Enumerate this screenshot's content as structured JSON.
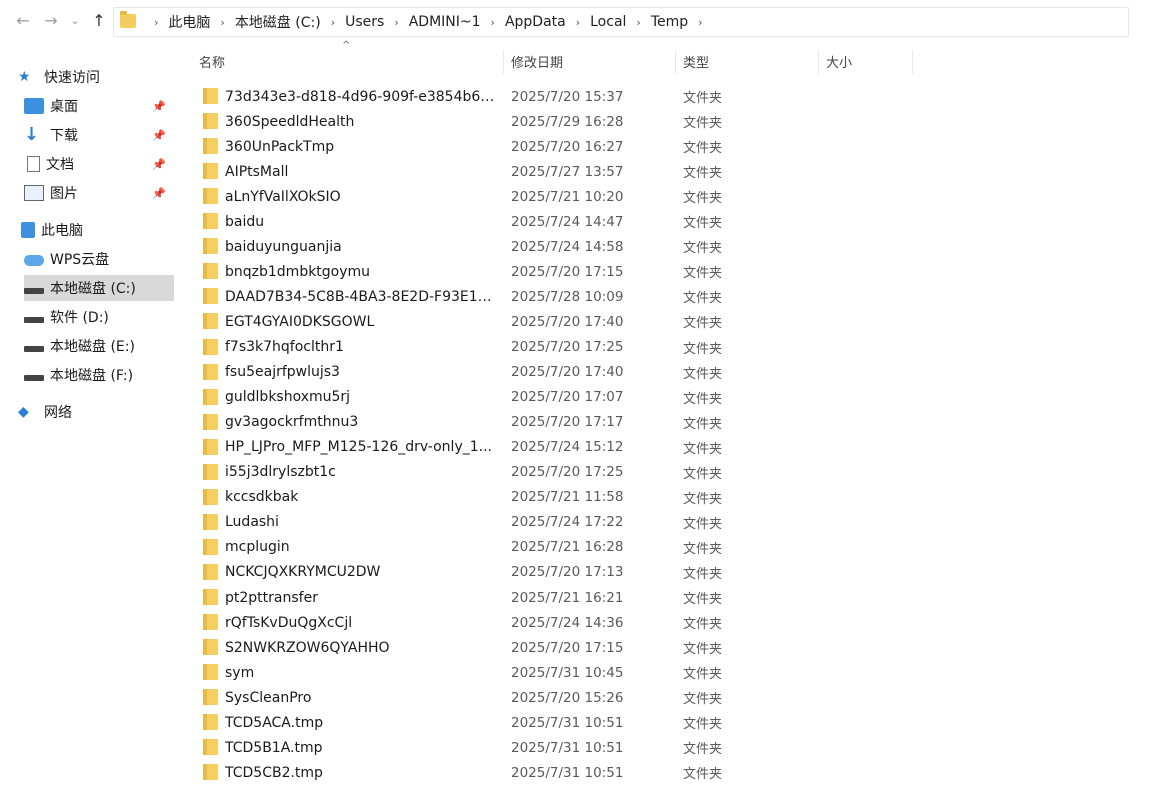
{
  "address_bar": {
    "crumbs": [
      "此电脑",
      "本地磁盘 (C:)",
      "Users",
      "ADMINI~1",
      "AppData",
      "Local",
      "Temp"
    ]
  },
  "nav_icons": {
    "back": "←",
    "forward": "→",
    "recent": "⌄",
    "up": "↑"
  },
  "sidebar": {
    "quick_access": {
      "label": "快速访问",
      "items": [
        {
          "label": "桌面",
          "icon": "desktop-icon",
          "pinned": true
        },
        {
          "label": "下载",
          "icon": "download-icon",
          "pinned": true
        },
        {
          "label": "文档",
          "icon": "document-icon",
          "pinned": true
        },
        {
          "label": "图片",
          "icon": "picture-icon",
          "pinned": true
        }
      ]
    },
    "this_pc": {
      "label": "此电脑"
    },
    "drives": [
      {
        "label": "WPS云盘",
        "icon": "cloud-icon",
        "selected": false
      },
      {
        "label": "本地磁盘 (C:)",
        "icon": "drive-icon",
        "selected": true
      },
      {
        "label": "软件 (D:)",
        "icon": "drive-icon",
        "selected": false
      },
      {
        "label": "本地磁盘 (E:)",
        "icon": "drive-icon",
        "selected": false
      },
      {
        "label": "本地磁盘 (F:)",
        "icon": "drive-icon",
        "selected": false
      }
    ],
    "network": {
      "label": "网络"
    }
  },
  "columns": {
    "name": "名称",
    "date": "修改日期",
    "type": "类型",
    "size": "大小",
    "sort_caret": "^"
  },
  "files": [
    {
      "name": "73d343e3-d818-4d96-909f-e3854b68...",
      "date": "2025/7/20 15:37",
      "type": "文件夹"
    },
    {
      "name": "360SpeedldHealth",
      "date": "2025/7/29 16:28",
      "type": "文件夹"
    },
    {
      "name": "360UnPackTmp",
      "date": "2025/7/20 16:27",
      "type": "文件夹"
    },
    {
      "name": "AIPtsMall",
      "date": "2025/7/27 13:57",
      "type": "文件夹"
    },
    {
      "name": "aLnYfVaIlXOkSIO",
      "date": "2025/7/21 10:20",
      "type": "文件夹"
    },
    {
      "name": "baidu",
      "date": "2025/7/24 14:47",
      "type": "文件夹"
    },
    {
      "name": "baiduyunguanjia",
      "date": "2025/7/24 14:58",
      "type": "文件夹"
    },
    {
      "name": "bnqzb1dmbktgoymu",
      "date": "2025/7/20 17:15",
      "type": "文件夹"
    },
    {
      "name": "DAAD7B34-5C8B-4BA3-8E2D-F93E12...",
      "date": "2025/7/28 10:09",
      "type": "文件夹"
    },
    {
      "name": "EGT4GYAI0DKSGOWL",
      "date": "2025/7/20 17:40",
      "type": "文件夹"
    },
    {
      "name": "f7s3k7hqfoclthr1",
      "date": "2025/7/20 17:25",
      "type": "文件夹"
    },
    {
      "name": "fsu5eajrfpwlujs3",
      "date": "2025/7/20 17:40",
      "type": "文件夹"
    },
    {
      "name": "guldlbkshoxmu5rj",
      "date": "2025/7/20 17:07",
      "type": "文件夹"
    },
    {
      "name": "gv3agockrfmthnu3",
      "date": "2025/7/20 17:17",
      "type": "文件夹"
    },
    {
      "name": "HP_LJPro_MFP_M125-126_drv-only_1...",
      "date": "2025/7/24 15:12",
      "type": "文件夹"
    },
    {
      "name": "i55j3dlrylszbt1c",
      "date": "2025/7/20 17:25",
      "type": "文件夹"
    },
    {
      "name": "kccsdkbak",
      "date": "2025/7/21 11:58",
      "type": "文件夹"
    },
    {
      "name": "Ludashi",
      "date": "2025/7/24 17:22",
      "type": "文件夹"
    },
    {
      "name": "mcplugin",
      "date": "2025/7/21 16:28",
      "type": "文件夹"
    },
    {
      "name": "NCKCJQXKRYMCU2DW",
      "date": "2025/7/20 17:13",
      "type": "文件夹"
    },
    {
      "name": "pt2pttransfer",
      "date": "2025/7/21 16:21",
      "type": "文件夹"
    },
    {
      "name": "rQfTsKvDuQgXcCjl",
      "date": "2025/7/24 14:36",
      "type": "文件夹"
    },
    {
      "name": "S2NWKRZOW6QYAHHO",
      "date": "2025/7/20 17:15",
      "type": "文件夹"
    },
    {
      "name": "sym",
      "date": "2025/7/31 10:45",
      "type": "文件夹"
    },
    {
      "name": "SysCleanPro",
      "date": "2025/7/20 15:26",
      "type": "文件夹"
    },
    {
      "name": "TCD5ACA.tmp",
      "date": "2025/7/31 10:51",
      "type": "文件夹"
    },
    {
      "name": "TCD5B1A.tmp",
      "date": "2025/7/31 10:51",
      "type": "文件夹"
    },
    {
      "name": "TCD5CB2.tmp",
      "date": "2025/7/31 10:51",
      "type": "文件夹"
    }
  ]
}
